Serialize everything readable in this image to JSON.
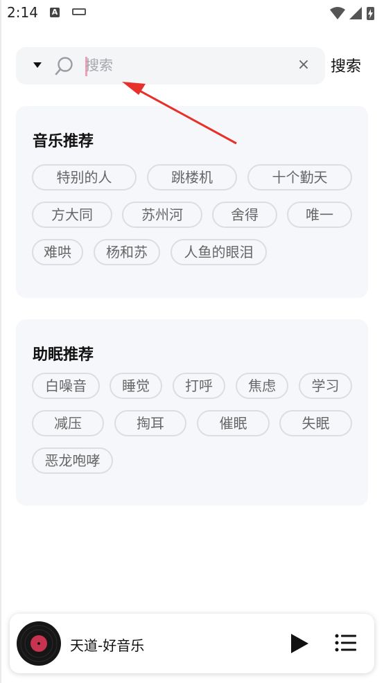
{
  "status_bar": {
    "time": "2:14",
    "notification_icon": "A"
  },
  "search": {
    "placeholder": "搜索",
    "value": "",
    "button_label": "搜索",
    "clear_symbol": "×"
  },
  "music_recommend": {
    "title": "音乐推荐",
    "tags": [
      "特别的人",
      "跳楼机",
      "十个勤天",
      "方大同",
      "苏州河",
      "舍得",
      "唯一",
      "难哄",
      "杨和苏",
      "人鱼的眼泪"
    ]
  },
  "sleep_recommend": {
    "title": "助眠推荐",
    "tags": [
      "白噪音",
      "睡觉",
      "打呼",
      "焦虑",
      "学习",
      "减压",
      "掏耳",
      "催眠",
      "失眠",
      "恶龙咆哮"
    ]
  },
  "player": {
    "song_title": "天道-好音乐"
  },
  "colors": {
    "annotation_arrow": "#e8302a",
    "disc_center": "#c8334f",
    "card_background": "#f6f7fa"
  },
  "icons": [
    "dropdown-icon",
    "search-icon",
    "clear-icon",
    "play-icon",
    "playlist-icon",
    "wifi-icon",
    "signal-icon",
    "battery-icon",
    "keyboard-icon"
  ]
}
